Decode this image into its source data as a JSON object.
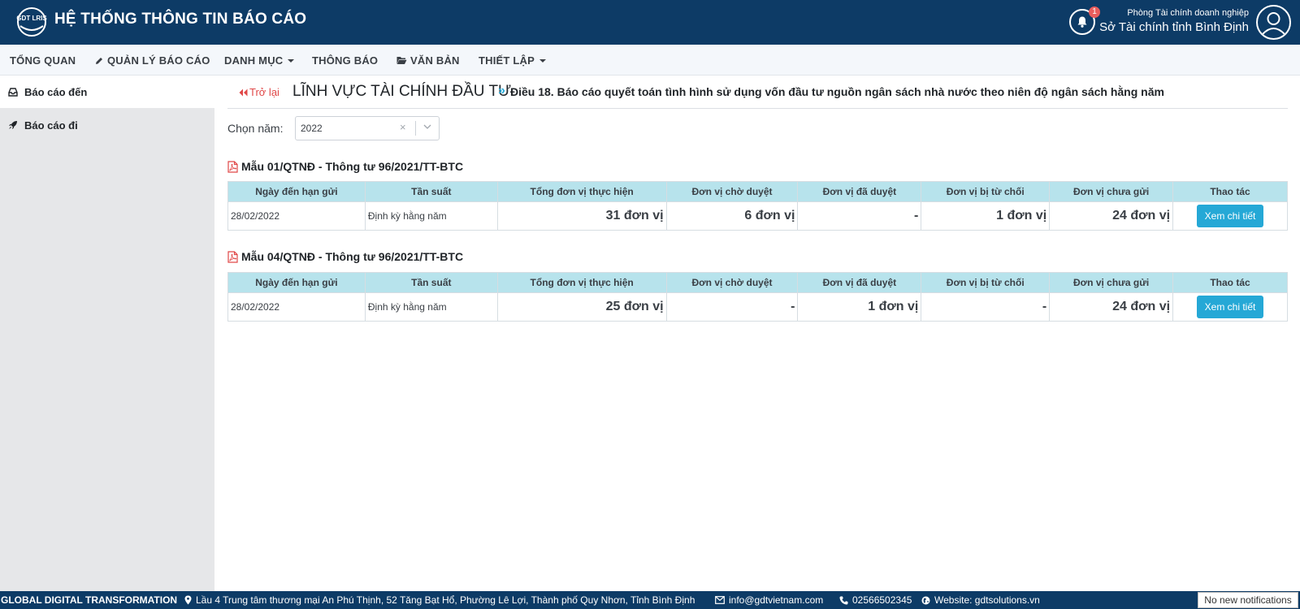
{
  "header": {
    "logo_text": "GDT LRIS",
    "title": "HỆ THỐNG THÔNG TIN BÁO CÁO",
    "notification_count": "1",
    "user_sub": "Phòng Tài chính doanh nghiệp",
    "user_main": "Sở Tài chính tỉnh Bình Định"
  },
  "nav": {
    "items": [
      "TỔNG QUAN",
      "QUẢN LÝ BÁO CÁO",
      "DANH MỤC",
      "THÔNG BÁO",
      "VĂN BẢN",
      "THIẾT LẬP"
    ]
  },
  "sidebar": {
    "items": [
      "Báo cáo đến",
      "Báo cáo đi"
    ]
  },
  "breadcrumb": {
    "back": "Trở lại",
    "section": "LĨNH VỰC TÀI CHÍNH ĐẦU TƯ",
    "separator": "»",
    "title": "Điều 18. Báo cáo quyết toán tình hình sử dụng vốn đầu tư nguồn ngân sách nhà nước theo niên độ ngân sách hằng năm"
  },
  "year_filter": {
    "label": "Chọn năm:",
    "value": "2022",
    "clear": "×"
  },
  "columns": [
    "Ngày đến hạn gửi",
    "Tần suất",
    "Tổng đơn vị thực hiện",
    "Đơn vị chờ duyệt",
    "Đơn vị đã duyệt",
    "Đơn vị bị từ chối",
    "Đơn vị chưa gửi",
    "Thao tác"
  ],
  "forms": [
    {
      "heading": "Mẫu 01/QTNĐ - Thông tư 96/2021/TT-BTC",
      "row": {
        "deadline": "28/02/2022",
        "frequency": "Định kỳ hằng năm",
        "total": "31 đơn vị",
        "pending": "6 đơn vị",
        "approved": "-",
        "rejected": "1 đơn vị",
        "not_sent": "24 đơn vị",
        "action": "Xem chi tiết"
      }
    },
    {
      "heading": "Mẫu 04/QTNĐ - Thông tư 96/2021/TT-BTC",
      "row": {
        "deadline": "28/02/2022",
        "frequency": "Định kỳ hằng năm",
        "total": "25 đơn vị",
        "pending": "-",
        "approved": "1 đơn vị",
        "rejected": "-",
        "not_sent": "24 đơn vị",
        "action": "Xem chi tiết"
      }
    }
  ],
  "footer": {
    "brand": "GLOBAL DIGITAL TRANSFORMATION",
    "address": "Lầu 4 Trung tâm thương mại An Phú Thịnh, 52 Tăng Bạt Hổ, Phường Lê Lợi, Thành phố Quy Nhơn, Tỉnh Bình Định",
    "email": "info@gdtvietnam.com",
    "phone": "02566502345",
    "website": "Website: gdtsolutions.vn",
    "notifications": "No new notifications"
  },
  "colors": {
    "header_bg": "#0d3b66",
    "table_header_bg": "#b7e3ec",
    "total": "#1d9fbf",
    "pending": "#6bc3dc",
    "approved": "#3fae59",
    "rejected": "#e05d5d",
    "not_sent": "#f0b93a",
    "button": "#25a8d6"
  }
}
